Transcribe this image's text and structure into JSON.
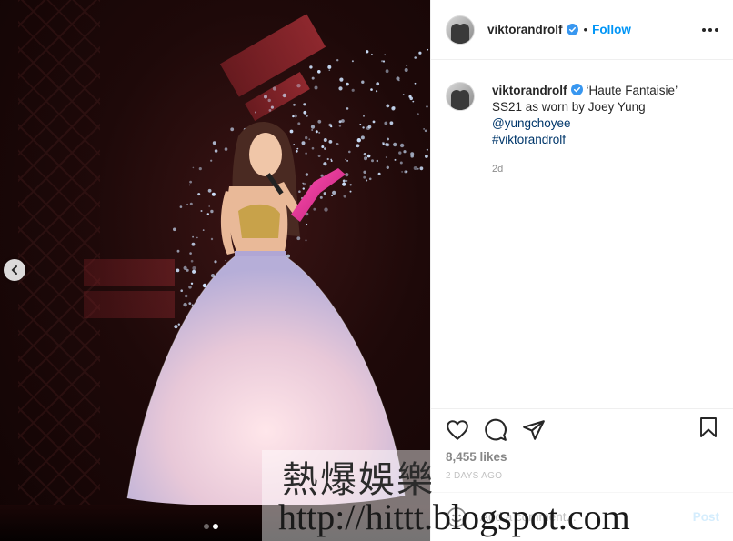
{
  "post": {
    "username": "viktorandrolf",
    "follow_label": "Follow",
    "separator": "•",
    "caption": {
      "username": "viktorandrolf",
      "text_before": "‘Haute Fantaisie’ SS21 as worn by Joey Yung ",
      "mention": "@yungchoyee",
      "hashtag": "#viktorandrolf",
      "time_ago": "2d"
    },
    "likes": "8,455 likes",
    "date": "2 DAYS AGO"
  },
  "comment": {
    "placeholder": "Add a comment...",
    "post_label": "Post"
  },
  "carousel": {
    "slide_count": 2,
    "active_slide": 2
  },
  "watermark": {
    "line1": "熱爆娛樂",
    "line2": "http://hittt.blogspot.com"
  },
  "colors": {
    "accent": "#0095f6",
    "link": "#00376b",
    "post_disabled": "#b2dffc",
    "muted": "#8e8e8e"
  },
  "icons": [
    "chevron-left-icon",
    "verified-badge-icon",
    "more-icon",
    "heart-icon",
    "comment-icon",
    "share-icon",
    "bookmark-icon",
    "emoji-icon"
  ]
}
